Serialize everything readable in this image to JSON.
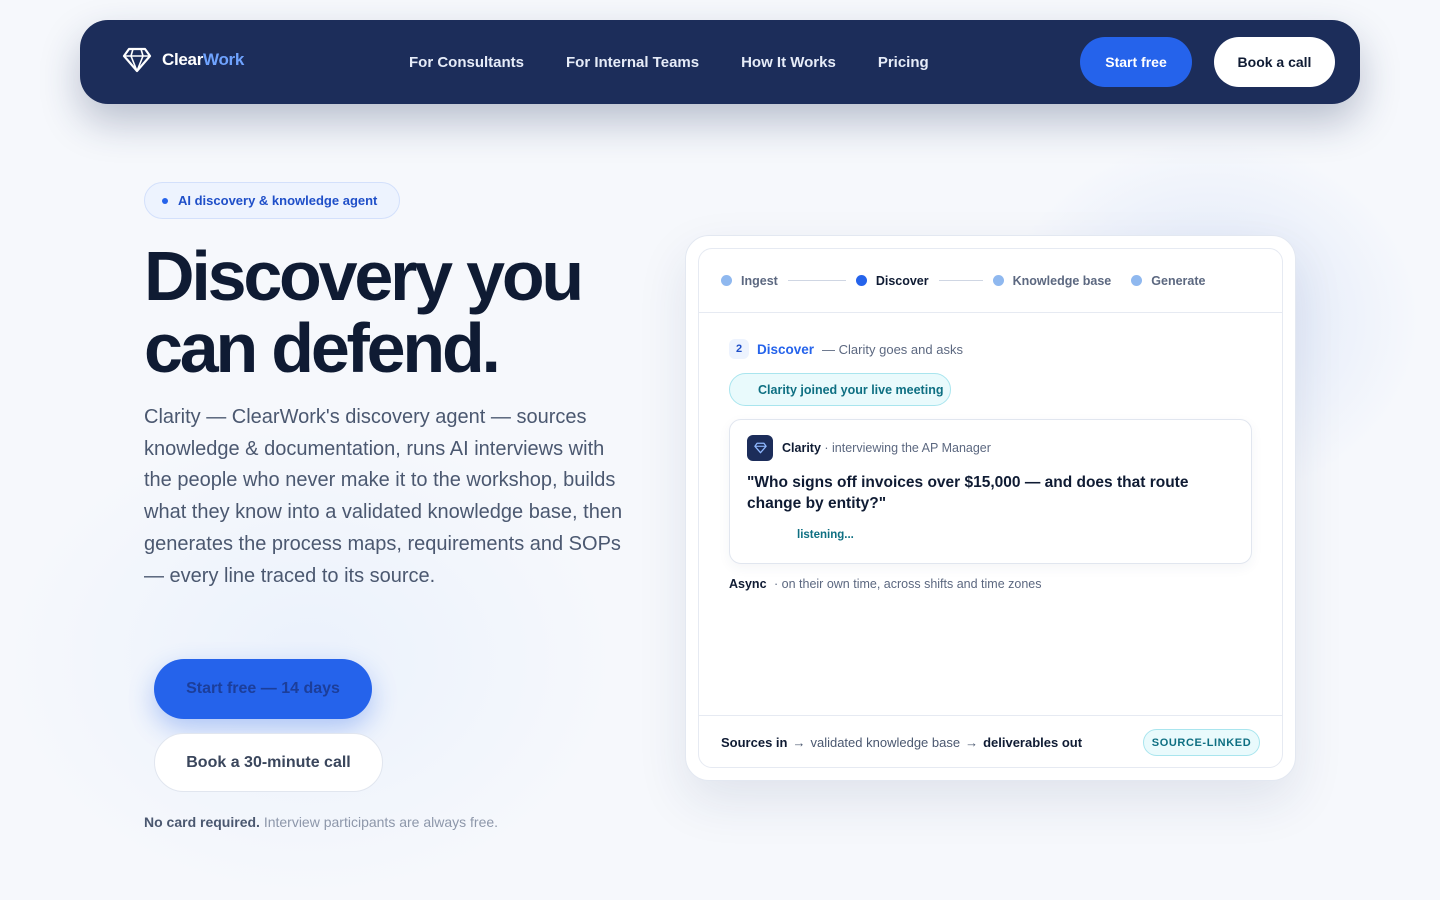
{
  "brand": {
    "name_part1": "Clear",
    "name_part2": "Work"
  },
  "nav": {
    "links": [
      "For Consultants",
      "For Internal Teams",
      "How It Works",
      "Pricing"
    ],
    "start_label": "Start free",
    "call_label": "Book a call"
  },
  "hero": {
    "pill": "AI discovery & knowledge agent",
    "headline_line1": "Discovery you",
    "headline_line2": "can defend.",
    "lede": "Clarity — ClearWork's discovery agent — sources knowledge & documentation, runs AI interviews with the people who never make it to the workshop, builds what they know into a validated knowledge base, then generates the process maps, requirements and SOPs — every line traced to its source.",
    "start_label": "Start free — 14 days",
    "call_label": "Book a 30-minute call",
    "footnote_strong": "No card required.",
    "footnote_soft": "Interview participants are always free."
  },
  "card": {
    "steps": [
      "Ingest",
      "Discover",
      "Knowledge base",
      "Generate"
    ],
    "active_step": 1,
    "phase_number": "2",
    "phase_title": "Discover",
    "phase_subtitle": "— Clarity goes and asks",
    "live_pill": "Clarity joined your live meeting",
    "question": {
      "name": "Clarity",
      "role": "· interviewing the AP Manager",
      "text": "\"Who signs off invoices over $15,000 — and does that route change by entity?\"",
      "status": "listening..."
    },
    "async_label": "Async",
    "async_desc": "· on their own time, across shifts and time zones",
    "footer": {
      "sources": "Sources in",
      "arrow": "→",
      "middle": "validated knowledge base",
      "deliverables": "deliverables out",
      "badge": "SOURCE-LINKED"
    }
  },
  "colors": {
    "nav_bg": "#1c2d5a",
    "accent": "#2563eb",
    "brand_accent": "#6fa3ff",
    "teal": "#0e6f82",
    "page_bg": "#f6f8fc"
  },
  "icons": [
    "diamond-logo-icon",
    "diamond-avatar-icon"
  ]
}
